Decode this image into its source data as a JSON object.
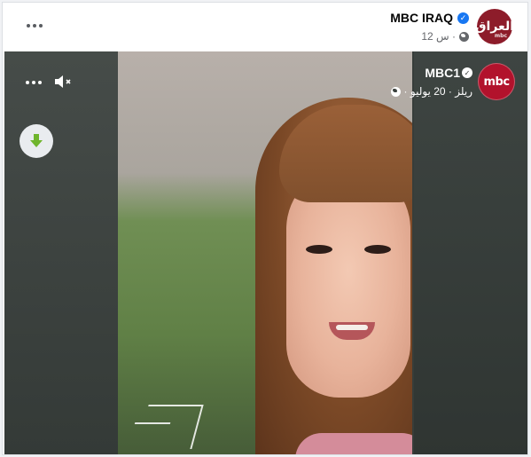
{
  "post": {
    "page_name": "MBC IRAQ",
    "avatar_text": "العراق",
    "avatar_sub": "mbc",
    "time": "12 س ·",
    "privacy_icon": "globe-icon",
    "verified_icon": "verified-badge-icon",
    "more_icon": "more-dots-icon"
  },
  "reel": {
    "author": "MBC1",
    "avatar_text": "mbc",
    "meta": "ريلز · 20 يوليو ·",
    "privacy_icon": "globe-icon",
    "more_icon": "more-dots-icon",
    "volume_icon": "speaker-muted-icon",
    "download_icon": "download-arrow-icon"
  },
  "colors": {
    "brand_blue": "#1877f2",
    "mbc_red": "#b2122c",
    "iraq_avatar": "#8d1c2a",
    "download_green": "#6fb52c"
  }
}
